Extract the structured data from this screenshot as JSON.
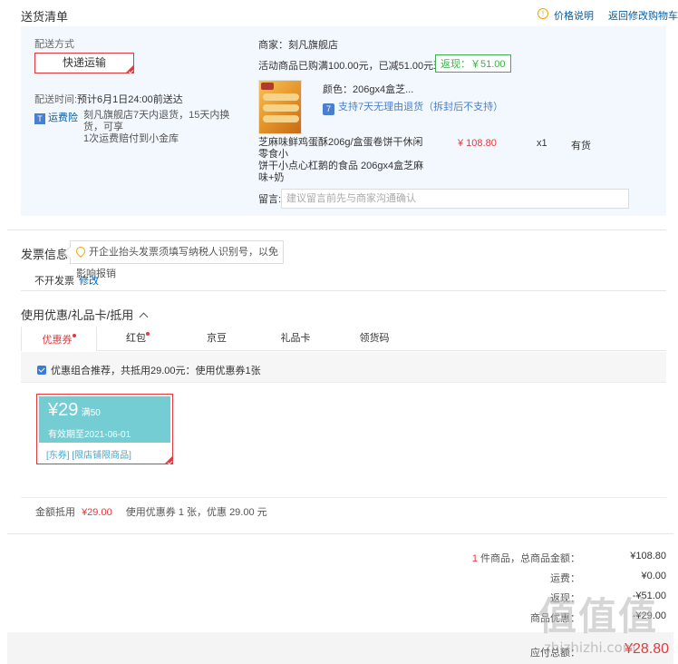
{
  "shipping": {
    "title": "送货清单",
    "price_note": "价格说明",
    "back_to_cart": "返回修改购物车",
    "delivery_method_label": "配送方式",
    "delivery_method": "快递运输",
    "delivery_time_label": "配送时间:",
    "delivery_time": "预计6月1日24:00前送达",
    "freight_label": "运费险",
    "freight_text_1": "刻凡旗舰店7天内退货，15天内换货，可享",
    "freight_text_2": "1次运费赔付到小金库",
    "merchant": "商家：刻凡旗舰店",
    "promo": "活动商品已购满100.00元，已减51.00元现金",
    "rebate": "返现：￥51.00",
    "product_color": "颜色：206gx4盒芝...",
    "return_policy": "支持7天无理由退货（拆封后不支持）",
    "product_name_1": "芝麻味鲜鸡蛋酥206g/盒蛋卷饼干休闲零食小",
    "product_name_2": "饼干小点心杠鹅的食品 206gx4盒芝麻味+奶",
    "price": "¥ 108.80",
    "qty": "x1",
    "stock": "有货",
    "note_label": "留言:",
    "note_placeholder": "建议留言前先与商家沟通确认"
  },
  "invoice": {
    "title": "发票信息",
    "tip": "开企业抬头发票须填写纳税人识别号，以免影响报销",
    "status": "不开发票",
    "edit": "修改"
  },
  "coupon": {
    "title": "使用优惠/礼品卡/抵用",
    "tabs": [
      "优惠券",
      "红包",
      "京豆",
      "礼品卡",
      "领货码"
    ],
    "combo_text": "优惠组合推荐，共抵用29.00元：使用优惠券1张",
    "amount": "¥29",
    "condition": "满50",
    "expiry": "有效期至2021-06-01",
    "scope": "[东券] [限店铺限商品]",
    "summary_label": "金额抵用",
    "summary_amount": "¥29.00",
    "summary_text": "使用优惠券 1 张，优惠 29.00 元"
  },
  "totals": {
    "count": "1",
    "count_label": "件商品，总商品金额：",
    "goods_total": "¥108.80",
    "freight_label": "运费：",
    "freight": "¥0.00",
    "cashback_label": "返现：",
    "cashback": "-¥51.00",
    "coupon_label": "商品优惠：",
    "coupon": "-¥29.00",
    "pay_label": "应付总额：",
    "pay_total": "¥28.80"
  },
  "watermark": {
    "logo": "值值值",
    "site": "zhizhizhi.com"
  },
  "colors": {
    "accent_red": "#e4393c",
    "link_blue": "#005ea7",
    "rebate_green": "#3db04c",
    "coupon_teal": "#74cdd3",
    "ship_bg": "#f3f8fe"
  }
}
